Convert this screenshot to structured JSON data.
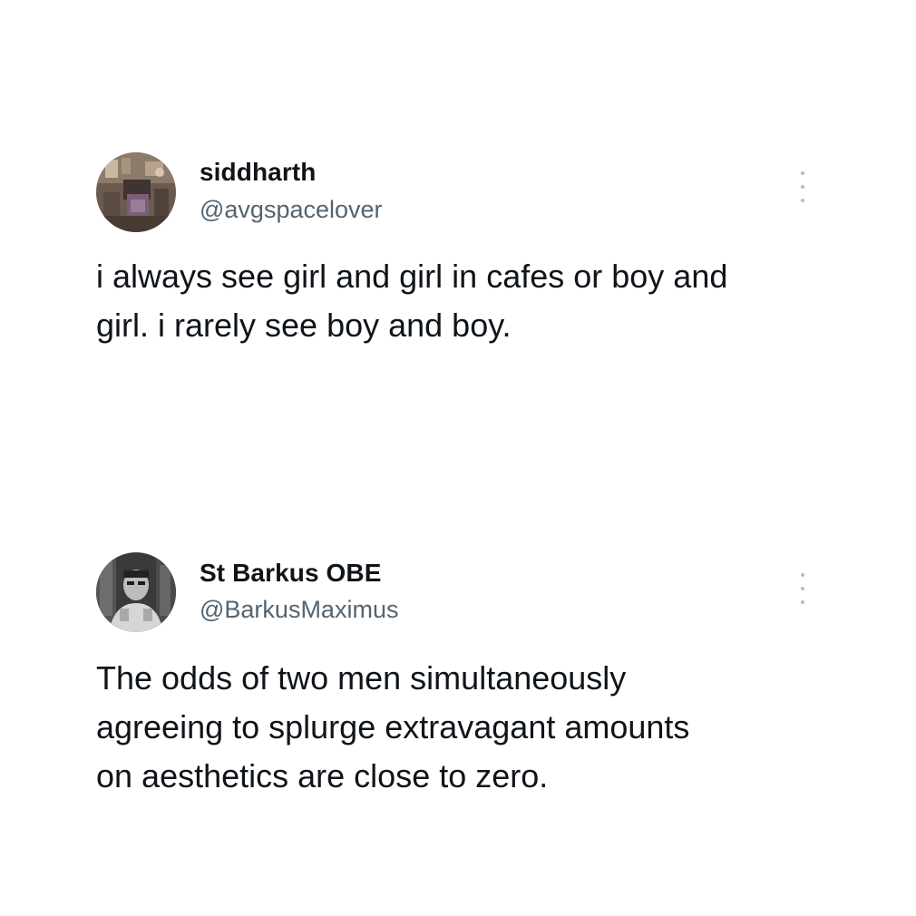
{
  "tweets": [
    {
      "display_name": "siddharth",
      "handle": "@avgspacelover",
      "text": "i always see girl and girl in cafes or boy and\ngirl. i rarely see boy and boy.",
      "avatar_icon": "user-avatar",
      "menu_icon": "more-vertical-icon"
    },
    {
      "display_name": "St Barkus OBE",
      "handle": "@BarkusMaximus",
      "text": "The odds of two men simultaneously\nagreeing to splurge extravagant amounts\non aesthetics are close to zero.",
      "avatar_icon": "user-avatar",
      "menu_icon": "more-vertical-icon"
    }
  ],
  "colors": {
    "text_primary": "#0f1419",
    "text_secondary": "#536471",
    "background": "#ffffff",
    "menu_dots": "#b7bdc2"
  }
}
